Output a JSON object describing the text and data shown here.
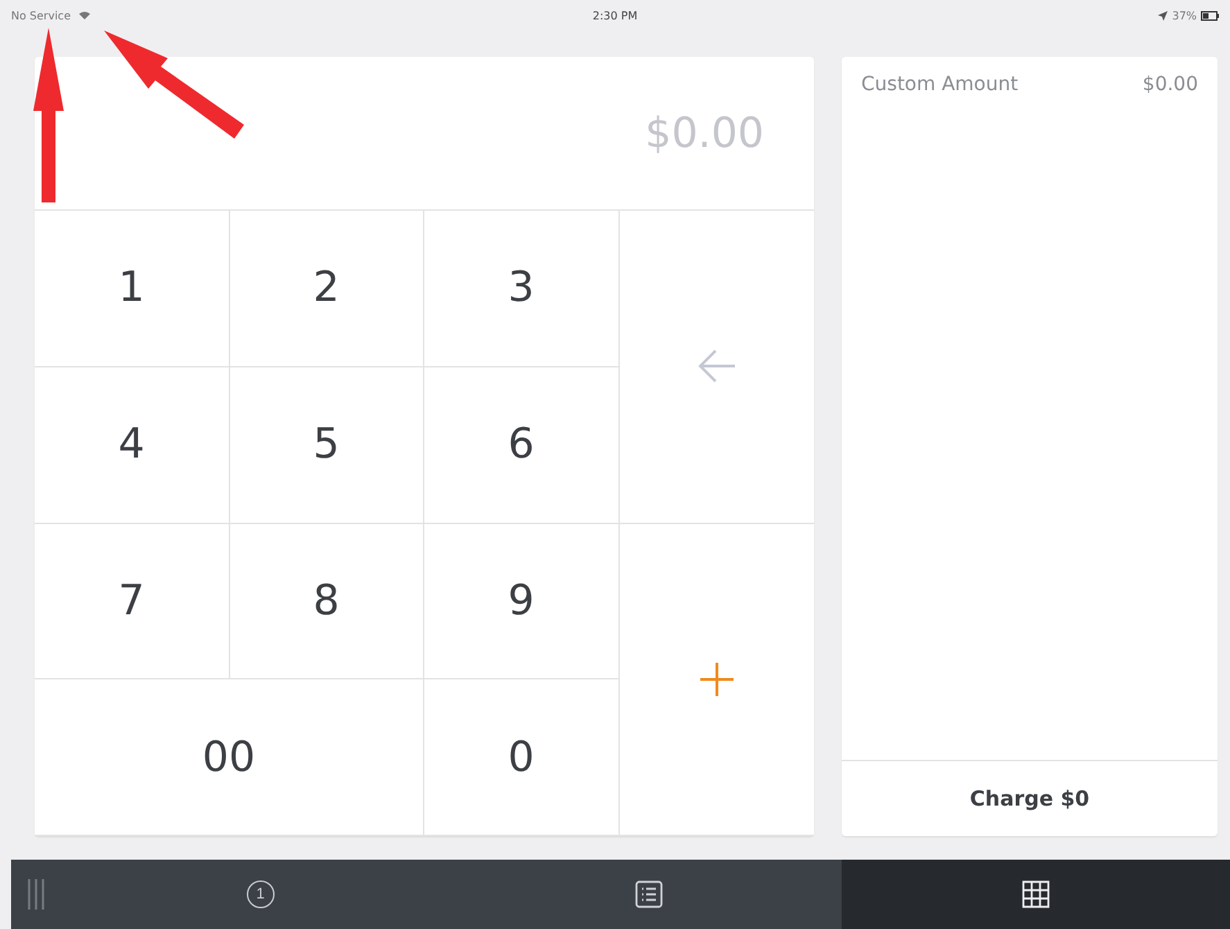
{
  "status_bar": {
    "carrier": "No Service",
    "time": "2:30 PM",
    "battery": "37%"
  },
  "keypad": {
    "amount": "$0.00",
    "keys": [
      {
        "kind": "digit",
        "label": "1"
      },
      {
        "kind": "digit",
        "label": "2"
      },
      {
        "kind": "digit",
        "label": "3"
      },
      {
        "kind": "backspace"
      },
      {
        "kind": "digit",
        "label": "4"
      },
      {
        "kind": "digit",
        "label": "5"
      },
      {
        "kind": "digit",
        "label": "6"
      },
      {
        "kind": "digit",
        "label": "7"
      },
      {
        "kind": "digit",
        "label": "8"
      },
      {
        "kind": "digit",
        "label": "9"
      },
      {
        "kind": "add"
      },
      {
        "kind": "wide",
        "label": "00"
      },
      {
        "kind": "digit",
        "label": "0"
      }
    ]
  },
  "cart": {
    "items": [
      {
        "name": "Custom Amount",
        "price": "$0.00"
      }
    ],
    "charge_button": "Charge $0"
  },
  "tab_bar": [
    {
      "kind": "handle",
      "selected": false
    },
    {
      "kind": "badge",
      "label": "1",
      "selected": false
    },
    {
      "kind": "list",
      "selected": false
    },
    {
      "kind": "grid",
      "selected": true
    }
  ],
  "annotations": [
    {
      "kind": "arrow"
    },
    {
      "kind": "arrow"
    }
  ]
}
